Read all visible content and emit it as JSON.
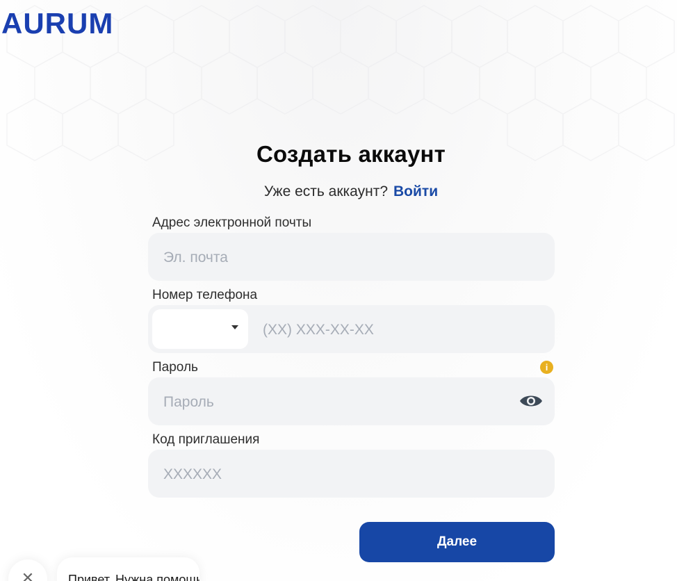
{
  "brand": {
    "logo_text": "AURUM",
    "logo_color": "#1a3fb0"
  },
  "header": {
    "title": "Создать аккаунт",
    "has_account_text": "Уже есть аккаунт?",
    "login_link": "Войти"
  },
  "form": {
    "email": {
      "label": "Адрес электронной почты",
      "placeholder": "Эл. почта",
      "value": ""
    },
    "phone": {
      "label": "Номер телефона",
      "country_code": "",
      "placeholder": "(XX) XXX-XX-XX",
      "value": ""
    },
    "password": {
      "label": "Пароль",
      "placeholder": "Пароль",
      "value": "",
      "info_icon": "info-icon",
      "toggle_icon": "eye-icon"
    },
    "invite": {
      "label": "Код приглашения",
      "placeholder": "XXXXXX",
      "value": ""
    },
    "next_label": "Далее"
  },
  "chat": {
    "close_icon": "close-icon",
    "message": "Привет. Нужна помощь?"
  },
  "colors": {
    "accent": "#1747a6",
    "link": "#1a4aa6",
    "info": "#e8b020",
    "input_bg": "#f2f3f5"
  }
}
